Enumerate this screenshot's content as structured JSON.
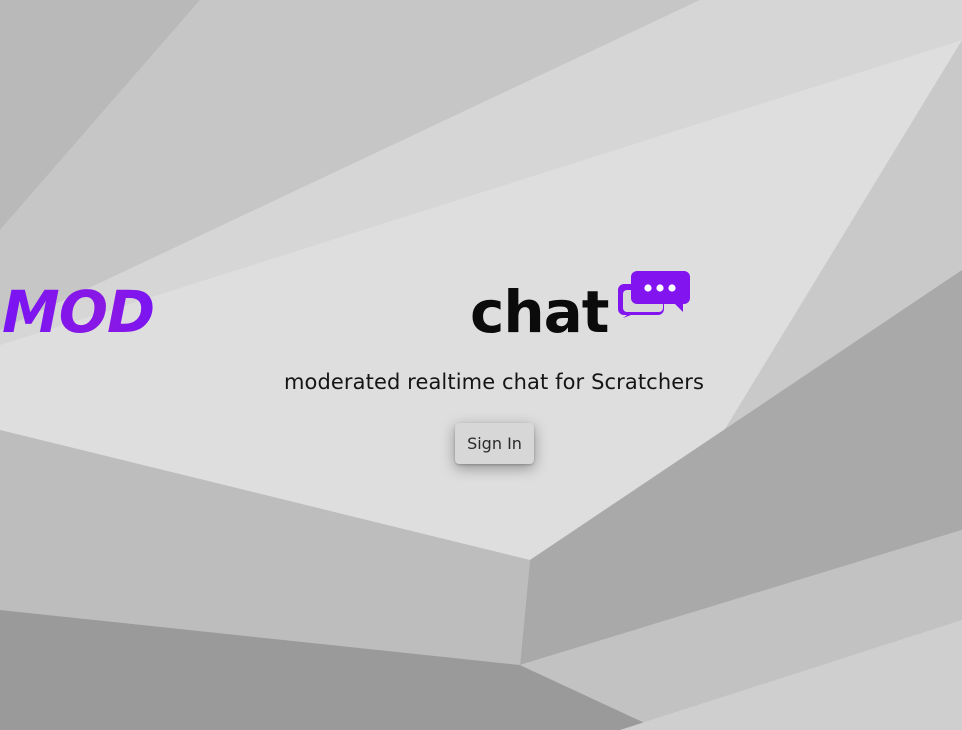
{
  "brand": {
    "logo_part1": "MOD",
    "logo_part2": "chat",
    "logo_icon": "chat-bubbles-icon",
    "accent_color": "#7b18ee"
  },
  "tagline": "moderated realtime chat for Scratchers",
  "actions": {
    "sign_in_label": "Sign In"
  }
}
